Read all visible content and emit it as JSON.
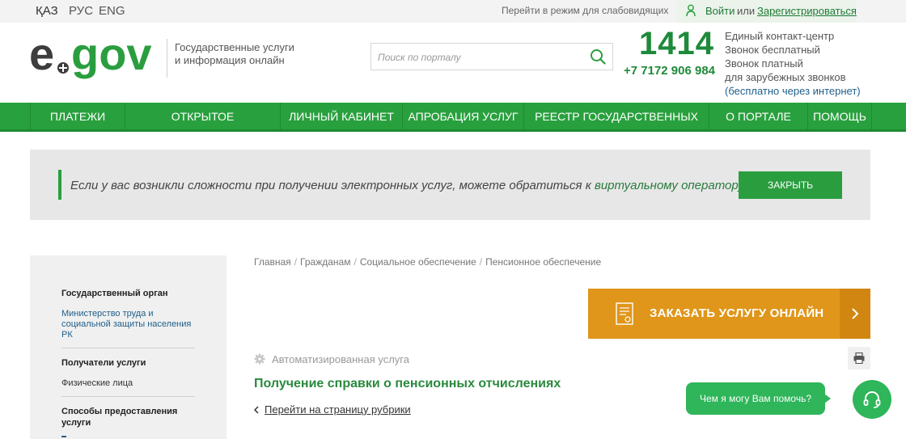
{
  "topbar": {
    "languages": [
      {
        "label": "ҚАЗ"
      },
      {
        "label": "РУС"
      },
      {
        "label": "ENG"
      }
    ],
    "impaired_mode": "Перейти в режим для слабовидящих",
    "login": "Войти",
    "or": "или",
    "register": "Зарегистрироваться"
  },
  "header": {
    "logo_text": "e gov",
    "tagline_line1": "Государственные услуги",
    "tagline_line2": "и информация онлайн",
    "search_placeholder": "Поиск по порталу",
    "phone_big": "1414",
    "phone_small": "+7 7172 906 984",
    "contact_line1": "Единый контакт-центр",
    "contact_line2": "Звонок бесплатный",
    "contact_line3": "Звонок платный",
    "contact_line4": "для зарубежных звонков",
    "contact_line5": "(бесплатно через интернет)"
  },
  "nav": {
    "items": [
      {
        "label": "ПЛАТЕЖИ"
      },
      {
        "label": "ОТКРЫТОЕ ПРАВИТЕЛЬСТВО"
      },
      {
        "label": "ЛИЧНЫЙ КАБИНЕТ"
      },
      {
        "label": "АПРОБАЦИЯ УСЛУГ"
      },
      {
        "label": "РЕЕСТР ГОСУДАРСТВЕННЫХ УСЛУГ"
      },
      {
        "label": "О ПОРТАЛЕ"
      },
      {
        "label": "ПОМОЩЬ"
      }
    ]
  },
  "alert": {
    "text": "Если у вас возникли сложности при получении электронных услуг, можете обратиться к",
    "link": "виртуальному оператору",
    "close_label": "ЗАКРЫТЬ"
  },
  "sidebar": {
    "gov_body_title": "Государственный орган",
    "gov_body_line1": "Министерство труда и",
    "gov_body_line2": "социальной защиты населения",
    "gov_body_line3": "РК",
    "recipients_title": "Получатели услуги",
    "recipients_value": "Физические лица",
    "methods_title_line1": "Способы предоставления",
    "methods_title_line2": "услуги"
  },
  "breadcrumb": {
    "items": [
      {
        "label": "Главная"
      },
      {
        "label": "Гражданам"
      },
      {
        "label": "Социальное обеспечение"
      },
      {
        "label": "Пенсионное обеспечение"
      }
    ]
  },
  "main": {
    "order_button": "ЗАКАЗАТЬ УСЛУГУ ОНЛАЙН",
    "auto_service": "Автоматизированная услуга",
    "service_title": "Получение справки о пенсионных отчислениях",
    "back_link": "Перейти на страницу рубрики"
  },
  "chat": {
    "bubble_text": "Чем я могу Вам помочь?"
  },
  "colors": {
    "brand_green": "#29a03e",
    "dark_green": "#1e8a3a",
    "order_orange": "#e0961a",
    "chat_green": "#2fb55a"
  }
}
